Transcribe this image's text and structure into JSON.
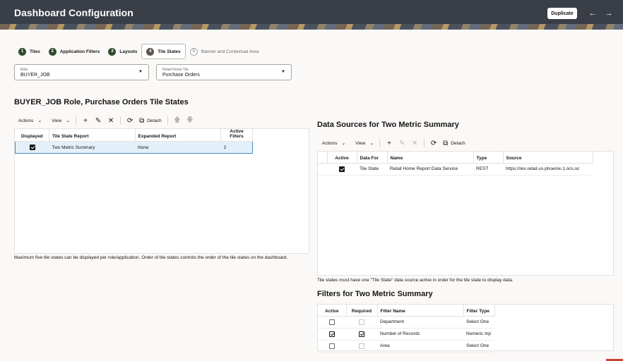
{
  "header": {
    "title": "Dashboard Configuration",
    "duplicate_label": "Duplicate",
    "back_icon": "arrow-left-icon",
    "forward_icon": "arrow-right-icon"
  },
  "steps": [
    {
      "num": "1",
      "label": "Tiles"
    },
    {
      "num": "2",
      "label": "Application Filters"
    },
    {
      "num": "3",
      "label": "Layouts"
    },
    {
      "num": "4",
      "label": "Tile States"
    },
    {
      "num": "5",
      "label": "Banner and Contextual Area"
    }
  ],
  "role_select": {
    "label": "Role",
    "value": "BUYER_JOB"
  },
  "tile_select": {
    "label": "Retail Home Tile",
    "value": "Purchase Orders"
  },
  "tile_states": {
    "title": "BUYER_JOB Role, Purchase Orders Tile States",
    "toolbar": {
      "actions": "Actions",
      "view": "View",
      "detach": "Detach"
    },
    "columns": [
      "Displayed",
      "Tile State Report",
      "Expanded Report",
      "Active Filters"
    ],
    "rows": [
      {
        "displayed": true,
        "report": "Two Metric Summary",
        "expanded": "None",
        "filters": "2"
      }
    ],
    "note": "Maximum five tile states can be displayed per role/application. Order of tile states controls the order of the tile states on the dashboard."
  },
  "data_sources": {
    "title": "Data Sources for Two Metric Summary",
    "toolbar": {
      "actions": "Actions",
      "view": "View",
      "detach": "Detach"
    },
    "columns": [
      "Active",
      "Data For",
      "Name",
      "Type",
      "Source"
    ],
    "rows": [
      {
        "active": true,
        "data_for": "Tile State",
        "name": "Retail Home Report Data Service",
        "type": "REST",
        "source": "https://rex.retail.us-phoenix-1.ocs.oc"
      }
    ],
    "note": "Tile states must have one \"Tile State\" data source active in order for the tile state to display data."
  },
  "filters": {
    "title": "Filters for Two Metric Summary",
    "columns": [
      "Active",
      "Required",
      "Filter Name",
      "Filter Type"
    ],
    "rows": [
      {
        "active": false,
        "required": false,
        "name": "Department",
        "type": "Select One"
      },
      {
        "active": true,
        "required": true,
        "name": "Number of Records",
        "type": "Numeric Inp"
      },
      {
        "active": false,
        "required": false,
        "name": "Area",
        "type": "Select One"
      }
    ]
  }
}
